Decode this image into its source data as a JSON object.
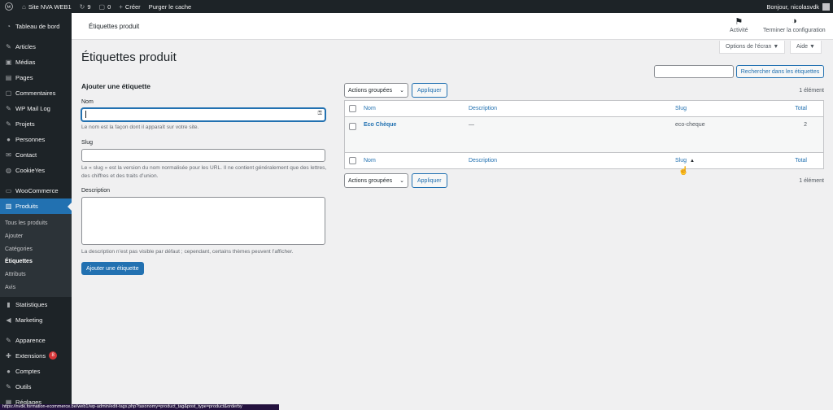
{
  "adminbar": {
    "site_name": "Site NVA WEB1",
    "updates_count": "9",
    "comments_count": "0",
    "new_label": "Créer",
    "purge_label": "Purger le cache",
    "greeting": "Bonjour, nicolasvdk"
  },
  "sidebar": {
    "items": [
      {
        "label": "Tableau de bord",
        "icon": "dashboard-icon"
      },
      {
        "label": "Articles",
        "icon": "pin-icon"
      },
      {
        "label": "Médias",
        "icon": "media-icon"
      },
      {
        "label": "Pages",
        "icon": "pages-icon"
      },
      {
        "label": "Commentaires",
        "icon": "comment-icon"
      },
      {
        "label": "WP Mail Log",
        "icon": "pin-icon"
      },
      {
        "label": "Projets",
        "icon": "pin-icon"
      },
      {
        "label": "Personnes",
        "icon": "people-icon"
      },
      {
        "label": "Contact",
        "icon": "mail-icon"
      },
      {
        "label": "CookieYes",
        "icon": "cookie-icon"
      },
      {
        "label": "WooCommerce",
        "icon": "woo-icon"
      },
      {
        "label": "Produits",
        "icon": "archive-icon"
      },
      {
        "label": "Statistiques",
        "icon": "chart-icon"
      },
      {
        "label": "Marketing",
        "icon": "megaphone-icon"
      },
      {
        "label": "Apparence",
        "icon": "brush-icon"
      },
      {
        "label": "Extensions",
        "icon": "plugin-icon",
        "badge": "8"
      },
      {
        "label": "Comptes",
        "icon": "user-icon"
      },
      {
        "label": "Outils",
        "icon": "wrench-icon"
      },
      {
        "label": "Réglages",
        "icon": "settings-icon"
      }
    ],
    "submenu": [
      "Tous les produits",
      "Ajouter",
      "Catégories",
      "Étiquettes",
      "Attributs",
      "Avis"
    ]
  },
  "status_url": "https://nvdk.formation-ecommerce.be/web1/wp-admin/edit-tags.php?taxonomy=product_tag&post_type=product&orderby",
  "header": {
    "title": "Étiquettes produit",
    "activity_label": "Activité",
    "setup_label": "Terminer la configuration",
    "screen_options": "Options de l’écran ▼",
    "help": "Aide ▼"
  },
  "page_title": "Étiquettes produit",
  "form": {
    "heading": "Ajouter une étiquette",
    "name_label": "Nom",
    "name_help": "Le nom est la façon dont il apparaît sur votre site.",
    "slug_label": "Slug",
    "slug_help": "Le « slug » est la version du nom normalisée pour les URL. Il ne contient généralement que des lettres, des chiffres et des traits d’union.",
    "desc_label": "Description",
    "desc_help": "La description n’est pas visible par défaut ; cependant, certains thèmes peuvent l’afficher.",
    "submit": "Ajouter une étiquette"
  },
  "search_button": "Rechercher dans les étiquettes",
  "tablenav": {
    "bulk_label": "Actions groupées",
    "apply": "Appliquer",
    "count": "1 élément"
  },
  "table": {
    "columns": {
      "name": "Nom",
      "description": "Description",
      "slug": "Slug",
      "total": "Total"
    },
    "rows": [
      {
        "name": "Eco Chèque",
        "description": "—",
        "slug": "eco-cheque",
        "total": "2"
      }
    ]
  },
  "colors": {
    "accent": "#2271b1",
    "sidebar": "#1d2327",
    "badge": "#d63638"
  }
}
